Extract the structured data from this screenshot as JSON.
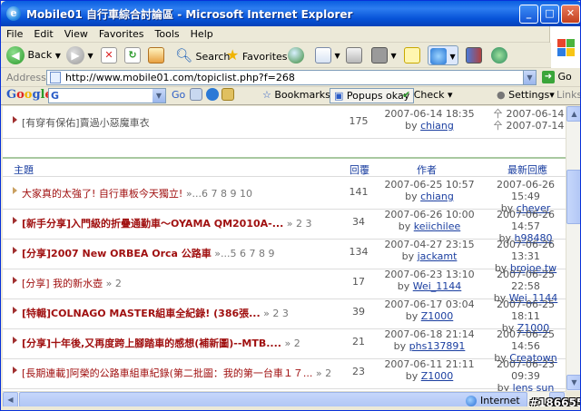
{
  "window": {
    "title": "Mobile01 自行車綜合討論區 - Microsoft Internet Explorer",
    "min": "_",
    "max": "□",
    "close": "✕"
  },
  "menu": [
    "File",
    "Edit",
    "View",
    "Favorites",
    "Tools",
    "Help"
  ],
  "toolbar": {
    "back": "Back",
    "search": "Search",
    "favorites": "Favorites"
  },
  "address": {
    "label": "Address",
    "url": "http://www.mobile01.com/topiclist.php?f=268",
    "go": "Go"
  },
  "google": {
    "logo": "Google",
    "g": "G",
    "go": "Go",
    "bookmarks": "Bookmarks▾",
    "popups": "Popups okay",
    "check": "Check ▾",
    "settings": "Settings▾",
    "links": "Links"
  },
  "colors": {
    "topic_red": "#a01010",
    "link_blue": "#1a3ea0",
    "title_blue": "#0753d8"
  },
  "pinned": {
    "topic": "[有穿有保佑]賣過小惡魔車衣",
    "replies": "175",
    "author_date": "2007-06-14 18:35",
    "author": "chiang",
    "last_a": "2007-06-14",
    "last_b": "2007-07-14"
  },
  "table_header": {
    "topic": "主題",
    "replies": "回覆",
    "author": "作者",
    "last": "最新回應"
  },
  "rows": [
    {
      "topic": "大家真的太強了! 自行車板今天獨立!",
      "pages": "»...6 7 8 9 10",
      "replies": "141",
      "adate": "2007-06-25 10:57",
      "author": "chiang",
      "ldate": "2007-06-26 15:49",
      "luser": "chever"
    },
    {
      "topic": "[新手分享]入門級的折疊通勤車～OYAMA QM2010A-...",
      "pages": "» 2 3",
      "replies": "34",
      "adate": "2007-06-26 10:00",
      "author": "keiichilee",
      "ldate": "2007-06-26 14:57",
      "luser": "h98480"
    },
    {
      "topic": "[分享]2007 New ORBEA Orca 公路車",
      "pages": "»...5 6 7 8 9",
      "replies": "134",
      "adate": "2007-04-27 23:15",
      "author": "jackamt",
      "ldate": "2007-06-26 13:31",
      "luser": "brojoe.tw"
    },
    {
      "topic": "[分享] 我的新水壺",
      "pages": "» 2",
      "replies": "17",
      "adate": "2007-06-23 13:10",
      "author": "Wei_1144",
      "ldate": "2007-06-25 22:58",
      "luser": "Wei_1144"
    },
    {
      "topic": "[特輯]COLNAGO MASTER組車全紀錄! (386張...",
      "pages": "» 2 3",
      "replies": "39",
      "adate": "2007-06-17 03:04",
      "author": "Z1000",
      "ldate": "2007-06-25 18:11",
      "luser": "Z1000"
    },
    {
      "topic": "[分享]十年後,又再度跨上腳踏車的感想(補新圖)--MTB....",
      "pages": "» 2",
      "replies": "21",
      "adate": "2007-06-18 21:14",
      "author": "phs137891",
      "ldate": "2007-06-25 14:56",
      "luser": "Creatown"
    },
    {
      "topic": "[長期連載]阿榮的公路車組車紀錄(第二批圖：我的第一台車１７...",
      "pages": "» 2",
      "replies": "23",
      "adate": "2007-06-11 21:11",
      "author": "Z1000",
      "ldate": "2007-06-23 09:39",
      "luser": "lens sun"
    }
  ],
  "status": {
    "zone": "Internet",
    "watermark": "#186655"
  }
}
